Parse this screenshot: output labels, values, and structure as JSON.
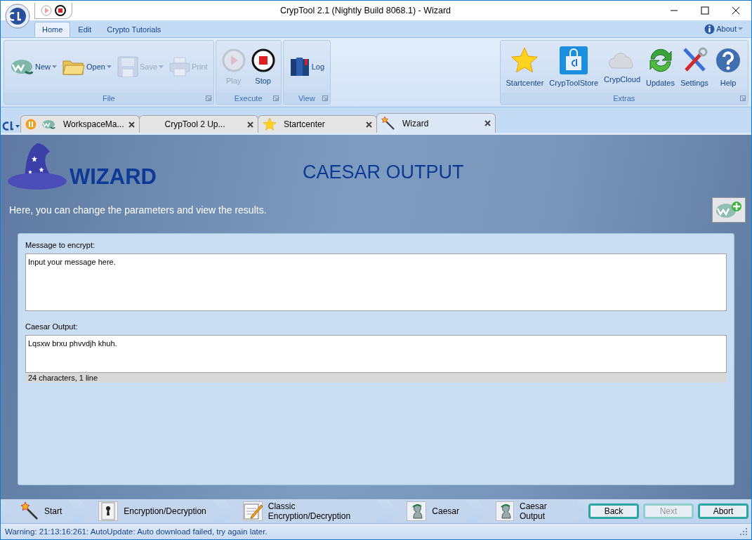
{
  "window": {
    "title": "CrypTool 2.1 (Nightly Build 8068.1) - Wizard"
  },
  "ribbon_tabs": [
    {
      "label": "Home",
      "selected": true
    },
    {
      "label": "Edit",
      "selected": false
    },
    {
      "label": "Crypto Tutorials",
      "selected": false
    }
  ],
  "about": "About",
  "ribbon_groups": [
    {
      "label": "File",
      "buttons": [
        {
          "kind": "small",
          "label": "New",
          "dropdown": true,
          "disabled": false
        },
        {
          "kind": "small",
          "label": "Open",
          "dropdown": true,
          "disabled": false
        },
        {
          "kind": "small",
          "label": "Save",
          "dropdown": true,
          "disabled": true
        },
        {
          "kind": "small",
          "label": "Print",
          "dropdown": false,
          "disabled": true
        }
      ]
    },
    {
      "label": "Execute",
      "buttons": [
        {
          "kind": "large",
          "label": "Play",
          "dropdown": false,
          "disabled": true
        },
        {
          "kind": "large",
          "label": "Stop",
          "dropdown": false,
          "disabled": false
        }
      ]
    },
    {
      "label": "View",
      "buttons": [
        {
          "kind": "small",
          "label": "Log",
          "dropdown": false,
          "disabled": false
        }
      ]
    },
    {
      "label": "Extras",
      "buttons": [
        {
          "kind": "large",
          "label": "Startcenter",
          "dropdown": false,
          "disabled": false
        },
        {
          "kind": "large",
          "label": "CrypToolStore",
          "dropdown": false,
          "disabled": false
        },
        {
          "kind": "large",
          "label": "CrypCloud",
          "dropdown": false,
          "disabled": false
        },
        {
          "kind": "large",
          "label": "Updates",
          "dropdown": false,
          "disabled": false
        },
        {
          "kind": "large",
          "label": "Settings",
          "dropdown": false,
          "disabled": false
        },
        {
          "kind": "large",
          "label": "Help",
          "dropdown": false,
          "disabled": false
        }
      ]
    }
  ],
  "doc_tabs": [
    {
      "label": "WorkspaceMa...",
      "selected": false,
      "paused": true
    },
    {
      "label": "CrypTool 2 Up...",
      "selected": false,
      "paused": false
    },
    {
      "label": "Startcenter",
      "selected": false,
      "paused": false
    },
    {
      "label": "Wizard",
      "selected": true,
      "paused": false
    }
  ],
  "wizard": {
    "brand": "WIZARD",
    "title": "CAESAR OUTPUT",
    "description": "Here, you can change the parameters and view the results.",
    "fields": [
      {
        "label": "Message to encrypt:",
        "value": "Input your message here."
      },
      {
        "label": "Caesar Output:",
        "value": "Lqsxw brxu phvvdjh khuh.",
        "info": "24 characters,  1 line"
      }
    ]
  },
  "steps": [
    {
      "label": "Start"
    },
    {
      "label": "Encryption/Decryption"
    },
    {
      "label": "Classic Encryption/Decryption"
    },
    {
      "label": "Caesar"
    },
    {
      "label": "Caesar Output"
    }
  ],
  "nav_buttons": [
    {
      "label": "Back",
      "disabled": false
    },
    {
      "label": "Next",
      "disabled": true
    },
    {
      "label": "Abort",
      "disabled": false
    }
  ],
  "status_bar": {
    "message": "Warning: 21:13:16:261: AutoUpdate: Auto download failed, try again later."
  }
}
